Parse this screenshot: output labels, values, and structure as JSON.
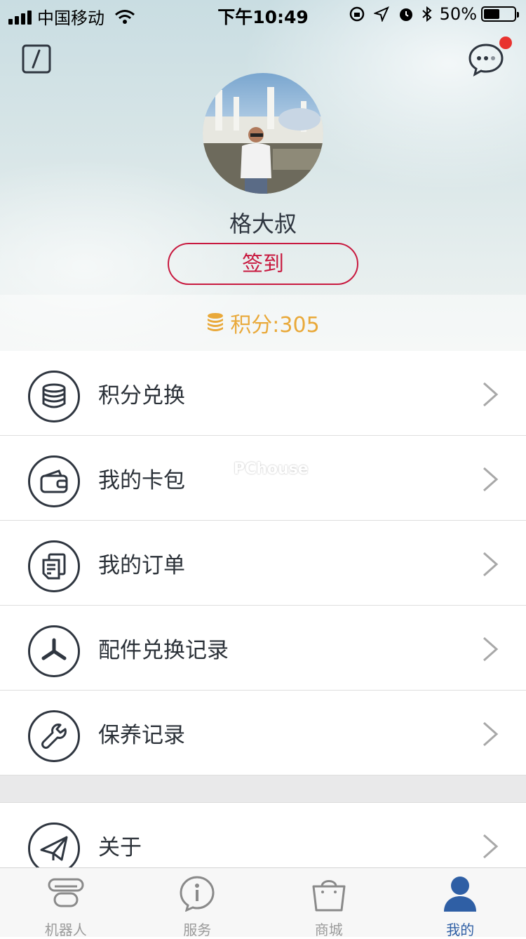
{
  "status_bar": {
    "carrier": "中国移动",
    "time": "下午10:49",
    "battery": "50%",
    "battery_level": 0.5
  },
  "header": {
    "username": "格大叔",
    "checkin_label": "签到",
    "points_label": "积分:305",
    "has_unread_message": true
  },
  "menu": {
    "items": [
      {
        "label": "积分兑换",
        "icon": "coins-icon"
      },
      {
        "label": "我的卡包",
        "icon": "wallet-icon"
      },
      {
        "label": "我的订单",
        "icon": "orders-icon"
      },
      {
        "label": "配件兑换记录",
        "icon": "propeller-icon"
      },
      {
        "label": "保养记录",
        "icon": "wrench-icon"
      }
    ],
    "items2": [
      {
        "label": "关于",
        "icon": "paper-plane-icon"
      }
    ]
  },
  "watermark": "PChouse",
  "tabbar": {
    "tabs": [
      {
        "label": "机器人",
        "icon": "robot-icon"
      },
      {
        "label": "服务",
        "icon": "info-icon"
      },
      {
        "label": "商城",
        "icon": "shopping-bag-icon"
      },
      {
        "label": "我的",
        "icon": "user-icon"
      }
    ],
    "active": "我的",
    "active_color": "#2f5fa5",
    "inactive_color": "#9a9a9a"
  },
  "colors": {
    "accent": "#c8193f",
    "points": "#e9a93a",
    "badge": "#e8332f"
  }
}
